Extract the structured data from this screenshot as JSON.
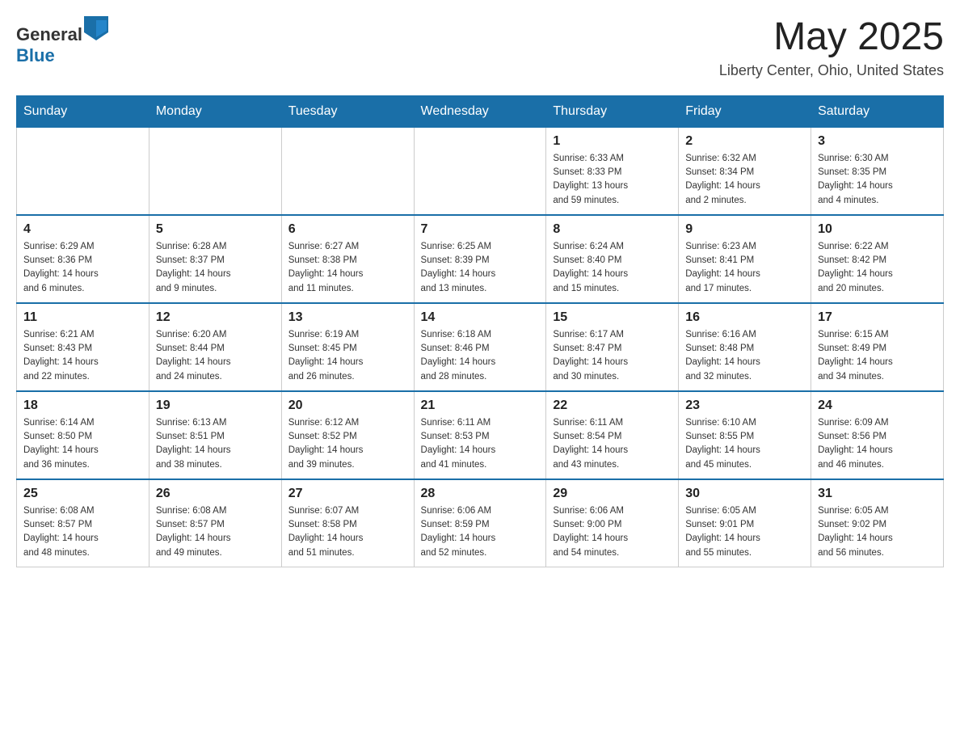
{
  "header": {
    "logo_general": "General",
    "logo_blue": "Blue",
    "month_year": "May 2025",
    "location": "Liberty Center, Ohio, United States"
  },
  "weekdays": [
    "Sunday",
    "Monday",
    "Tuesday",
    "Wednesday",
    "Thursday",
    "Friday",
    "Saturday"
  ],
  "weeks": [
    [
      {
        "day": "",
        "info": ""
      },
      {
        "day": "",
        "info": ""
      },
      {
        "day": "",
        "info": ""
      },
      {
        "day": "",
        "info": ""
      },
      {
        "day": "1",
        "info": "Sunrise: 6:33 AM\nSunset: 8:33 PM\nDaylight: 13 hours\nand 59 minutes."
      },
      {
        "day": "2",
        "info": "Sunrise: 6:32 AM\nSunset: 8:34 PM\nDaylight: 14 hours\nand 2 minutes."
      },
      {
        "day": "3",
        "info": "Sunrise: 6:30 AM\nSunset: 8:35 PM\nDaylight: 14 hours\nand 4 minutes."
      }
    ],
    [
      {
        "day": "4",
        "info": "Sunrise: 6:29 AM\nSunset: 8:36 PM\nDaylight: 14 hours\nand 6 minutes."
      },
      {
        "day": "5",
        "info": "Sunrise: 6:28 AM\nSunset: 8:37 PM\nDaylight: 14 hours\nand 9 minutes."
      },
      {
        "day": "6",
        "info": "Sunrise: 6:27 AM\nSunset: 8:38 PM\nDaylight: 14 hours\nand 11 minutes."
      },
      {
        "day": "7",
        "info": "Sunrise: 6:25 AM\nSunset: 8:39 PM\nDaylight: 14 hours\nand 13 minutes."
      },
      {
        "day": "8",
        "info": "Sunrise: 6:24 AM\nSunset: 8:40 PM\nDaylight: 14 hours\nand 15 minutes."
      },
      {
        "day": "9",
        "info": "Sunrise: 6:23 AM\nSunset: 8:41 PM\nDaylight: 14 hours\nand 17 minutes."
      },
      {
        "day": "10",
        "info": "Sunrise: 6:22 AM\nSunset: 8:42 PM\nDaylight: 14 hours\nand 20 minutes."
      }
    ],
    [
      {
        "day": "11",
        "info": "Sunrise: 6:21 AM\nSunset: 8:43 PM\nDaylight: 14 hours\nand 22 minutes."
      },
      {
        "day": "12",
        "info": "Sunrise: 6:20 AM\nSunset: 8:44 PM\nDaylight: 14 hours\nand 24 minutes."
      },
      {
        "day": "13",
        "info": "Sunrise: 6:19 AM\nSunset: 8:45 PM\nDaylight: 14 hours\nand 26 minutes."
      },
      {
        "day": "14",
        "info": "Sunrise: 6:18 AM\nSunset: 8:46 PM\nDaylight: 14 hours\nand 28 minutes."
      },
      {
        "day": "15",
        "info": "Sunrise: 6:17 AM\nSunset: 8:47 PM\nDaylight: 14 hours\nand 30 minutes."
      },
      {
        "day": "16",
        "info": "Sunrise: 6:16 AM\nSunset: 8:48 PM\nDaylight: 14 hours\nand 32 minutes."
      },
      {
        "day": "17",
        "info": "Sunrise: 6:15 AM\nSunset: 8:49 PM\nDaylight: 14 hours\nand 34 minutes."
      }
    ],
    [
      {
        "day": "18",
        "info": "Sunrise: 6:14 AM\nSunset: 8:50 PM\nDaylight: 14 hours\nand 36 minutes."
      },
      {
        "day": "19",
        "info": "Sunrise: 6:13 AM\nSunset: 8:51 PM\nDaylight: 14 hours\nand 38 minutes."
      },
      {
        "day": "20",
        "info": "Sunrise: 6:12 AM\nSunset: 8:52 PM\nDaylight: 14 hours\nand 39 minutes."
      },
      {
        "day": "21",
        "info": "Sunrise: 6:11 AM\nSunset: 8:53 PM\nDaylight: 14 hours\nand 41 minutes."
      },
      {
        "day": "22",
        "info": "Sunrise: 6:11 AM\nSunset: 8:54 PM\nDaylight: 14 hours\nand 43 minutes."
      },
      {
        "day": "23",
        "info": "Sunrise: 6:10 AM\nSunset: 8:55 PM\nDaylight: 14 hours\nand 45 minutes."
      },
      {
        "day": "24",
        "info": "Sunrise: 6:09 AM\nSunset: 8:56 PM\nDaylight: 14 hours\nand 46 minutes."
      }
    ],
    [
      {
        "day": "25",
        "info": "Sunrise: 6:08 AM\nSunset: 8:57 PM\nDaylight: 14 hours\nand 48 minutes."
      },
      {
        "day": "26",
        "info": "Sunrise: 6:08 AM\nSunset: 8:57 PM\nDaylight: 14 hours\nand 49 minutes."
      },
      {
        "day": "27",
        "info": "Sunrise: 6:07 AM\nSunset: 8:58 PM\nDaylight: 14 hours\nand 51 minutes."
      },
      {
        "day": "28",
        "info": "Sunrise: 6:06 AM\nSunset: 8:59 PM\nDaylight: 14 hours\nand 52 minutes."
      },
      {
        "day": "29",
        "info": "Sunrise: 6:06 AM\nSunset: 9:00 PM\nDaylight: 14 hours\nand 54 minutes."
      },
      {
        "day": "30",
        "info": "Sunrise: 6:05 AM\nSunset: 9:01 PM\nDaylight: 14 hours\nand 55 minutes."
      },
      {
        "day": "31",
        "info": "Sunrise: 6:05 AM\nSunset: 9:02 PM\nDaylight: 14 hours\nand 56 minutes."
      }
    ]
  ]
}
